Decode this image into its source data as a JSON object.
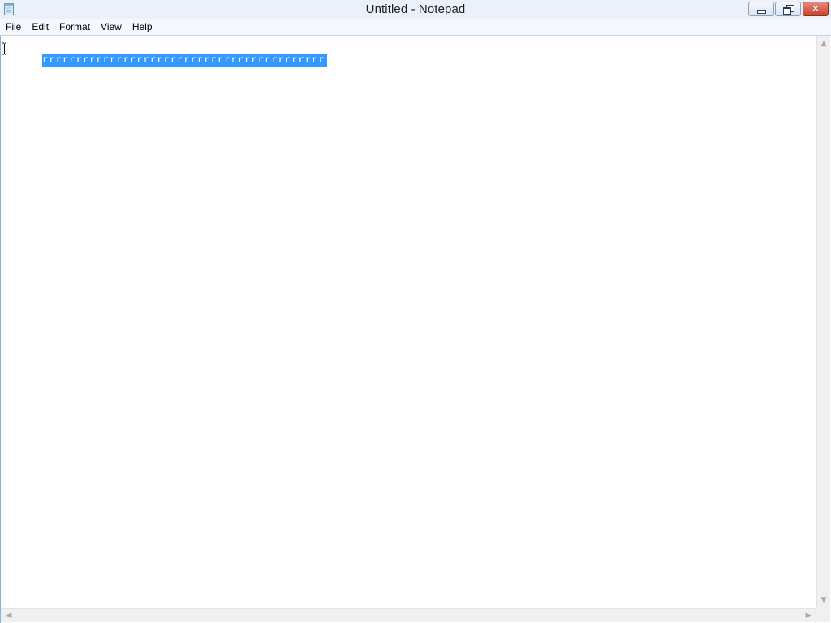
{
  "window": {
    "title": "Untitled - Notepad",
    "app_icon": "notepad-icon",
    "controls": {
      "minimize_icon": "minimize-icon",
      "maximize_icon": "restore-icon",
      "close_icon": "close-icon",
      "close_glyph": "✕"
    }
  },
  "menu": {
    "items": [
      {
        "label": "File"
      },
      {
        "label": "Edit"
      },
      {
        "label": "Format"
      },
      {
        "label": "View"
      },
      {
        "label": "Help"
      }
    ]
  },
  "editor": {
    "content": "rrrrrrrrrrrrrrrrrrrrrrrrrrrrrrrrrrrrrrrrrr",
    "selected": true,
    "selection_color": "#3399ff",
    "cursor_icon": "i-beam-cursor-icon"
  },
  "scrollbars": {
    "up_glyph": "▲",
    "down_glyph": "▼",
    "left_glyph": "◀",
    "right_glyph": "▶"
  }
}
